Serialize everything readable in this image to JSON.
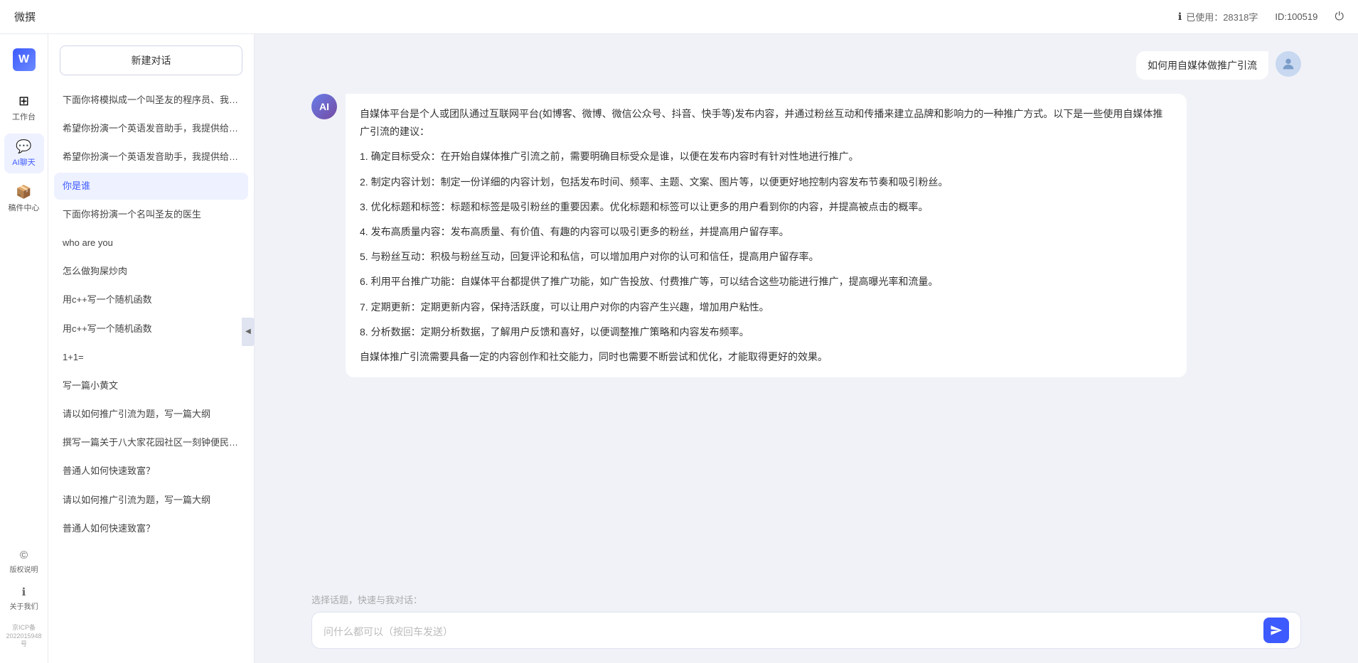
{
  "topbar": {
    "title": "微撰",
    "usage_label": "已使用：28318字",
    "id_label": "ID:100519",
    "usage_icon": "ℹ",
    "logout_icon": "⏻"
  },
  "nav": {
    "logo_text": "W 微撰",
    "items": [
      {
        "id": "workbench",
        "icon": "⊞",
        "label": "工作台"
      },
      {
        "id": "ai-chat",
        "icon": "💬",
        "label": "AI聊天"
      },
      {
        "id": "components",
        "icon": "📦",
        "label": "稿件中心"
      }
    ],
    "bottom_items": [
      {
        "id": "copyright",
        "icon": "©",
        "label": "版权说明"
      },
      {
        "id": "about",
        "icon": "ℹ",
        "label": "关于我们"
      }
    ],
    "icp": "京ICP备2022015948号"
  },
  "history": {
    "new_chat_label": "新建对话",
    "items": [
      {
        "id": "h1",
        "text": "下面你将模拟成一个叫圣友的程序员、我说...",
        "active": false
      },
      {
        "id": "h2",
        "text": "希望你扮演一个英语发音助手，我提供给你...",
        "active": false
      },
      {
        "id": "h3",
        "text": "希望你扮演一个英语发音助手，我提供给你...",
        "active": false
      },
      {
        "id": "h4",
        "text": "你是谁",
        "active": true
      },
      {
        "id": "h5",
        "text": "下面你将扮演一个名叫圣友的医生",
        "active": false
      },
      {
        "id": "h6",
        "text": "who are you",
        "active": false
      },
      {
        "id": "h7",
        "text": "怎么做狗屎炒肉",
        "active": false
      },
      {
        "id": "h8",
        "text": "用c++写一个随机函数",
        "active": false
      },
      {
        "id": "h9",
        "text": "用c++写一个随机函数",
        "active": false
      },
      {
        "id": "h10",
        "text": "1+1=",
        "active": false
      },
      {
        "id": "h11",
        "text": "写一篇小黄文",
        "active": false
      },
      {
        "id": "h12",
        "text": "请以如何推广引流为题，写一篇大纲",
        "active": false
      },
      {
        "id": "h13",
        "text": "撰写一篇关于八大家花园社区一刻钟便民生...",
        "active": false
      },
      {
        "id": "h14",
        "text": "普通人如何快速致富？",
        "active": false
      },
      {
        "id": "h15",
        "text": "请以如何推广引流为题，写一篇大纲",
        "active": false
      },
      {
        "id": "h16",
        "text": "普通人如何快速致富？",
        "active": false
      }
    ]
  },
  "chat": {
    "user_msg": "如何用自媒体做推广引流",
    "ai_response": {
      "paragraphs": [
        "自媒体平台是个人或团队通过互联网平台(如博客、微博、微信公众号、抖音、快手等)发布内容，并通过粉丝互动和传播来建立品牌和影响力的一种推广方式。以下是一些使用自媒体推广引流的建议：",
        "1. 确定目标受众：在开始自媒体推广引流之前，需要明确目标受众是谁，以便在发布内容时有针对性地进行推广。",
        "2. 制定内容计划：制定一份详细的内容计划，包括发布时间、频率、主题、文案、图片等，以便更好地控制内容发布节奏和吸引粉丝。",
        "3. 优化标题和标签：标题和标签是吸引粉丝的重要因素。优化标题和标签可以让更多的用户看到你的内容，并提高被点击的概率。",
        "4. 发布高质量内容：发布高质量、有价值、有趣的内容可以吸引更多的粉丝，并提高用户留存率。",
        "5. 与粉丝互动：积极与粉丝互动，回复评论和私信，可以增加用户对你的认可和信任，提高用户留存率。",
        "6. 利用平台推广功能：自媒体平台都提供了推广功能，如广告投放、付费推广等，可以结合这些功能进行推广，提高曝光率和流量。",
        "7. 定期更新：定期更新内容，保持活跃度，可以让用户对你的内容产生兴趣，增加用户粘性。",
        "8. 分析数据：定期分析数据，了解用户反馈和喜好，以便调整推广策略和内容发布频率。",
        "自媒体推广引流需要具备一定的内容创作和社交能力，同时也需要不断尝试和优化，才能取得更好的效果。"
      ]
    },
    "quick_topics_label": "选择话题，快速与我对话：",
    "input_placeholder": "问什么都可以（按回车发送）"
  }
}
